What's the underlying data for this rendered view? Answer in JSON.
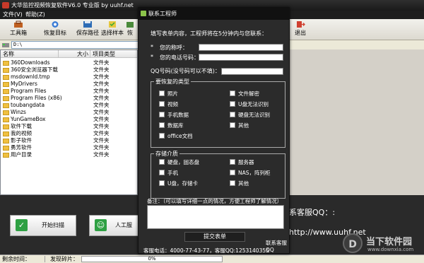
{
  "window": {
    "title": "大华监控视频恢复软件V6.0 专业版 by uuhf.net"
  },
  "menu": [
    "文件(V)",
    "帮助(Z)"
  ],
  "toolbar": {
    "items": [
      {
        "label": "工具箱",
        "icon": "toolbox-icon"
      },
      {
        "label": "恢复目标",
        "icon": "restore-target-icon"
      },
      {
        "label": "保存路径",
        "icon": "save-path-icon"
      },
      {
        "label": "选择样本",
        "icon": "select-sample-icon"
      },
      {
        "label": "恢",
        "icon": "restore-icon"
      }
    ],
    "exit_label": "退出"
  },
  "path": {
    "value": "D:\\"
  },
  "file_list": {
    "headers": [
      "名称",
      "大小",
      "项目类型"
    ],
    "rows": [
      {
        "name": "360Downloads",
        "type": "文件夹"
      },
      {
        "name": "360安全浏览器下载",
        "type": "文件夹"
      },
      {
        "name": "msdownld.tmp",
        "type": "文件夹"
      },
      {
        "name": "MyDrivers",
        "type": "文件夹"
      },
      {
        "name": "Program Files",
        "type": "文件夹"
      },
      {
        "name": "Program Files (x86)",
        "type": "文件夹"
      },
      {
        "name": "toubangdata",
        "type": "文件夹"
      },
      {
        "name": "Winzs",
        "type": "文件夹"
      },
      {
        "name": "YunGameBox",
        "type": "文件夹"
      },
      {
        "name": "软件下载",
        "type": "文件夹"
      },
      {
        "name": "我的视频",
        "type": "文件夹"
      },
      {
        "name": "影子软件",
        "type": "文件夹"
      },
      {
        "name": "勇芳软件",
        "type": "文件夹"
      },
      {
        "name": "用户目录",
        "type": "文件夹"
      }
    ]
  },
  "bottom": {
    "scan_button": "开始扫描",
    "manual_button": "人工服",
    "qq_text": "系客服QQ：:",
    "url_text": "http://www.uuhf.net"
  },
  "status": {
    "left_label": "剩余时间：",
    "middle_label": "发现碎片：",
    "progress_text": "0%",
    "progress_value": 0
  },
  "watermark": {
    "name": "当下软件园",
    "url": "www.downxia.com"
  },
  "dialog": {
    "title": "联系工程师",
    "intro": "填写表单内容，工程师将在5分钟内与您联系：",
    "name_label": "您的称呼：",
    "phone_label": "您的电话号码：",
    "qq_label": "QQ号码(没号码可以不填)：",
    "file_group_title": "要恢复的类型",
    "file_types": [
      {
        "label": "照片",
        "checked": false
      },
      {
        "label": "文件解密",
        "checked": false
      },
      {
        "label": "视频",
        "checked": false
      },
      {
        "label": "U盘无法识别",
        "checked": false
      },
      {
        "label": "手机数据",
        "checked": false
      },
      {
        "label": "硬盘无法识别",
        "checked": false
      },
      {
        "label": "数据库",
        "checked": false
      },
      {
        "label": "其他",
        "checked": false
      },
      {
        "label": "office文档",
        "checked": false
      }
    ],
    "media_group_title": "存储介质",
    "media_types": [
      {
        "label": "硬盘，固态盘",
        "checked": false
      },
      {
        "label": "服务器",
        "checked": false
      },
      {
        "label": "手机",
        "checked": false
      },
      {
        "label": "NAS，阵列柜",
        "checked": false
      },
      {
        "label": "U盘，存储卡",
        "checked": false
      },
      {
        "label": "其他",
        "checked": false
      }
    ],
    "remark_label": "备注：（可以填写详细一点的情况，方便工程师了解情况）",
    "submit_label": "提交表单",
    "contact_label": "联系客服QQ",
    "footer": "客服电话：4000-77-43-77，客服QQ:1253140355"
  }
}
